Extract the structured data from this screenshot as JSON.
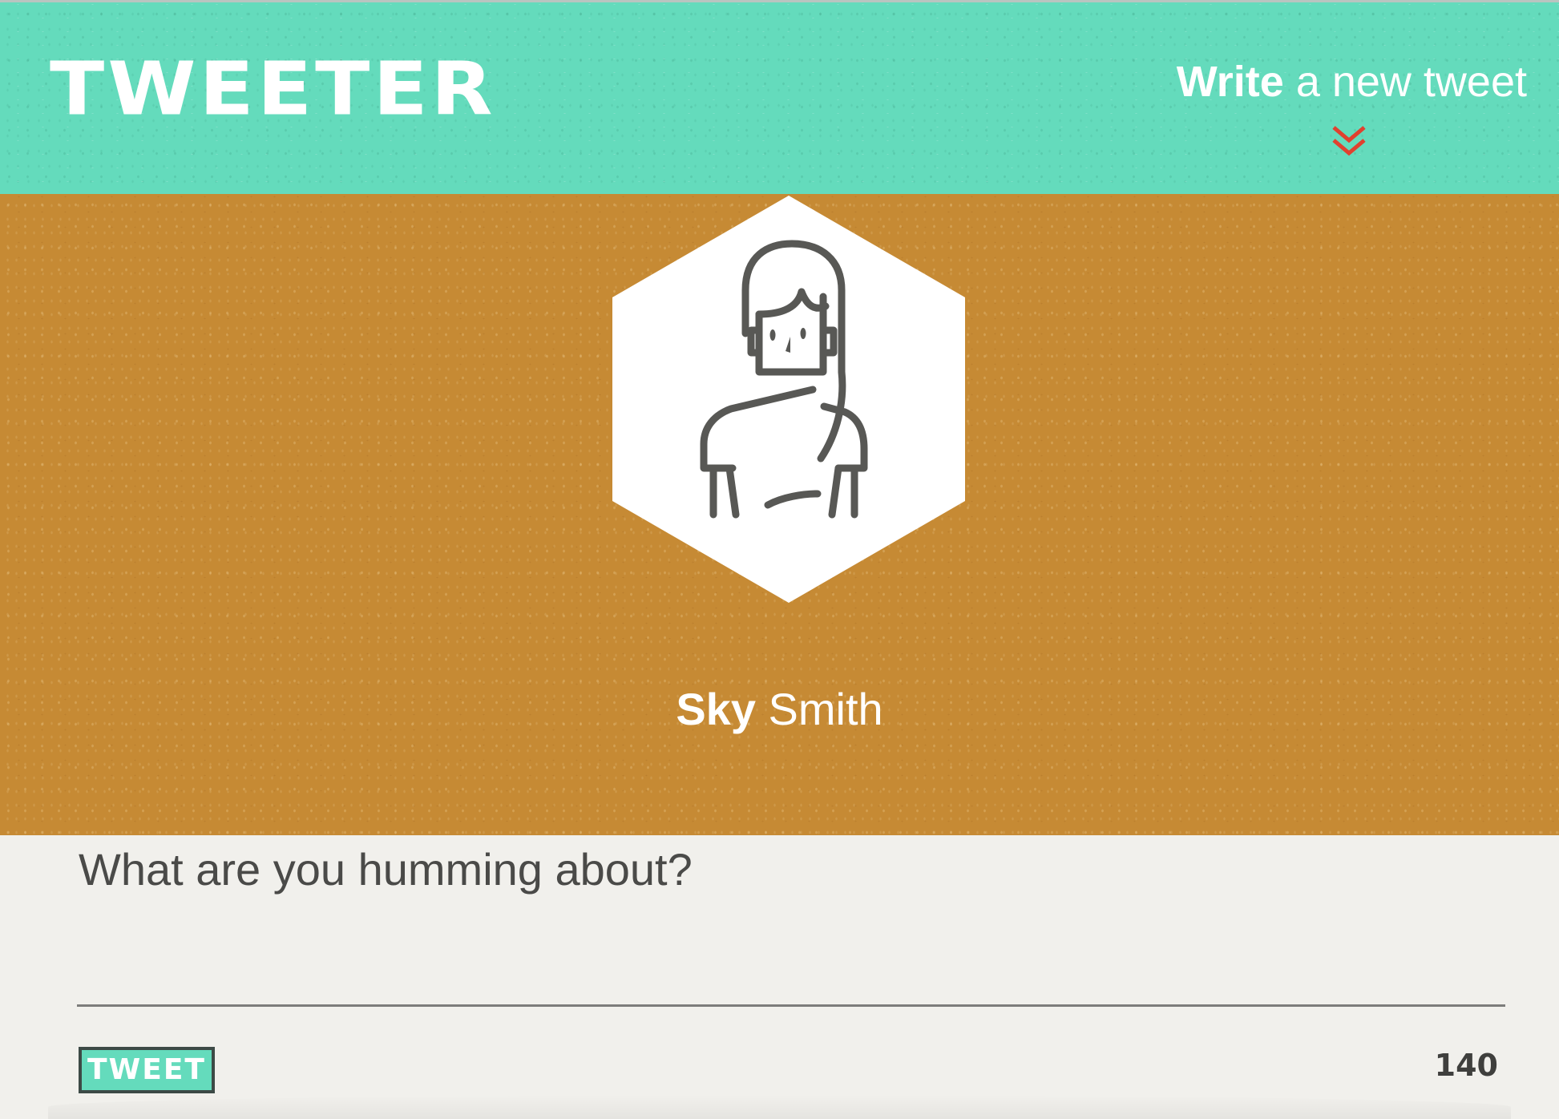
{
  "app": {
    "brand": "TWEETER"
  },
  "header": {
    "write_strong": "Write",
    "write_rest": " a new tweet",
    "chevron_icon": "double-chevron-down-icon",
    "chevron_color": "#e0412f"
  },
  "profile": {
    "first_name": "Sky",
    "last_name": " Smith",
    "avatar_icon": "woman-avatar-icon"
  },
  "composer": {
    "value": "",
    "placeholder": "What are you humming about?",
    "tweet_label": "TWEET",
    "char_count": "140"
  },
  "colors": {
    "header_bg": "#64dbbc",
    "banner_bg": "#c68a34",
    "composer_bg": "#f1f0ec",
    "accent": "#e0412f"
  }
}
